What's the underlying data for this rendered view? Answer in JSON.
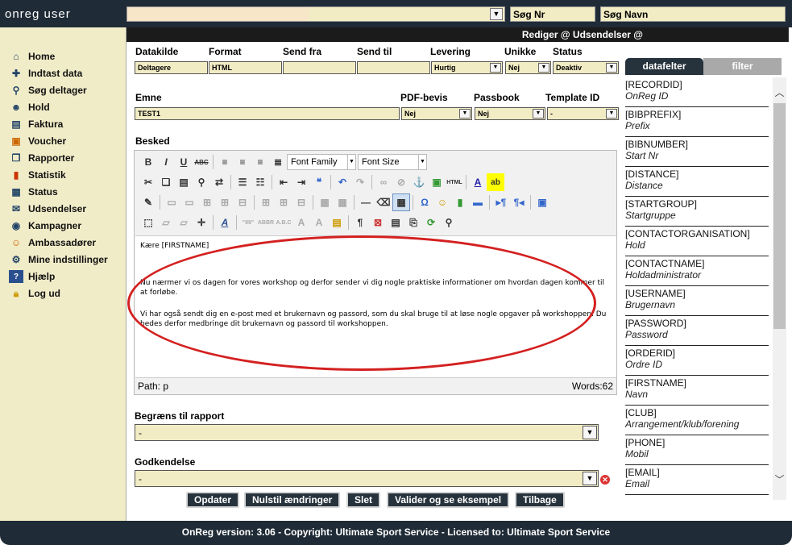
{
  "brand": "onreg user",
  "top": {
    "search_nr": "Søg Nr",
    "search_name": "Søg Navn"
  },
  "title": "Rediger @ Udsendelser @",
  "sidebar": {
    "items": [
      {
        "label": "Home",
        "icon": "home-icon"
      },
      {
        "label": "Indtast data",
        "icon": "add-user-icon"
      },
      {
        "label": "Søg deltager",
        "icon": "search-user-icon"
      },
      {
        "label": "Hold",
        "icon": "team-icon"
      },
      {
        "label": "Faktura",
        "icon": "invoice-icon"
      },
      {
        "label": "Voucher",
        "icon": "gift-icon"
      },
      {
        "label": "Rapporter",
        "icon": "reports-icon"
      },
      {
        "label": "Statistik",
        "icon": "bar-chart-icon"
      },
      {
        "label": "Status",
        "icon": "status-icon"
      },
      {
        "label": "Udsendelser",
        "icon": "mail-send-icon"
      },
      {
        "label": "Kampagner",
        "icon": "campaign-icon"
      },
      {
        "label": "Ambassadører",
        "icon": "ambassador-icon"
      },
      {
        "label": "Mine indstillinger",
        "icon": "gear-icon"
      },
      {
        "label": "Hjælp",
        "icon": "help-icon"
      },
      {
        "label": "Log ud",
        "icon": "lock-icon"
      }
    ]
  },
  "form": {
    "labels": {
      "datakilde": "Datakilde",
      "format": "Format",
      "send_fra": "Send fra",
      "send_til": "Send til",
      "levering": "Levering",
      "unikke": "Unikke",
      "status": "Status",
      "emne": "Emne",
      "pdf": "PDF-bevis",
      "passbook": "Passbook",
      "template": "Template ID",
      "besked": "Besked",
      "begraens": "Begræns til rapport",
      "godkendelse": "Godkendelse"
    },
    "values": {
      "datakilde": "Deltagere",
      "format": "HTML",
      "send_fra": "",
      "send_til": "",
      "levering": "Hurtig",
      "unikke": "Nej",
      "status": "Deaktiv",
      "emne": "TEST1",
      "pdf": "Nej",
      "passbook": "Nej",
      "template": "-",
      "begraens": "-",
      "godkendelse": "-"
    }
  },
  "editor": {
    "font_family": "Font Family",
    "font_size": "Font Size",
    "path": "Path: p",
    "words": "Words:62",
    "lines": [
      "Kære [FIRSTNAME]",
      "Nu nærmer vi os dagen for vores workshop og derfor sender vi dig nogle praktiske informationer om hvordan dagen kommer til at forløbe.",
      "Vi har også sendt dig en e-post med et brukernavn og passord, som du skal bruge til at løse nogle opgaver på workshoppen. Du bedes derfor medbringe dit brukernavn og passord til workshoppen."
    ]
  },
  "buttons": {
    "update": "Opdater",
    "reset": "Nulstil ændringer",
    "delete": "Slet",
    "validate": "Valider og se eksempel",
    "back": "Tilbage"
  },
  "tabs": {
    "fields": "datafelter",
    "filter": "filter"
  },
  "fields": [
    {
      "code": "[RECORDID]",
      "desc": "OnReg ID"
    },
    {
      "code": "[BIBPREFIX]",
      "desc": "Prefix"
    },
    {
      "code": "[BIBNUMBER]",
      "desc": "Start Nr"
    },
    {
      "code": "[DISTANCE]",
      "desc": "Distance"
    },
    {
      "code": "[STARTGROUP]",
      "desc": "Startgruppe"
    },
    {
      "code": "[CONTACTORGANISATION]",
      "desc": "Hold"
    },
    {
      "code": "[CONTACTNAME]",
      "desc": "Holdadministrator"
    },
    {
      "code": "[USERNAME]",
      "desc": "Brugernavn"
    },
    {
      "code": "[PASSWORD]",
      "desc": "Password"
    },
    {
      "code": "[ORDERID]",
      "desc": "Ordre ID"
    },
    {
      "code": "[FIRSTNAME]",
      "desc": "Navn"
    },
    {
      "code": "[CLUB]",
      "desc": "Arrangement/klub/forening"
    },
    {
      "code": "[PHONE]",
      "desc": "Mobil"
    },
    {
      "code": "[EMAIL]",
      "desc": "Email"
    }
  ],
  "footer": "OnReg version: 3.06 - Copyright: Ultimate Sport Service - Licensed to: Ultimate Sport Service"
}
